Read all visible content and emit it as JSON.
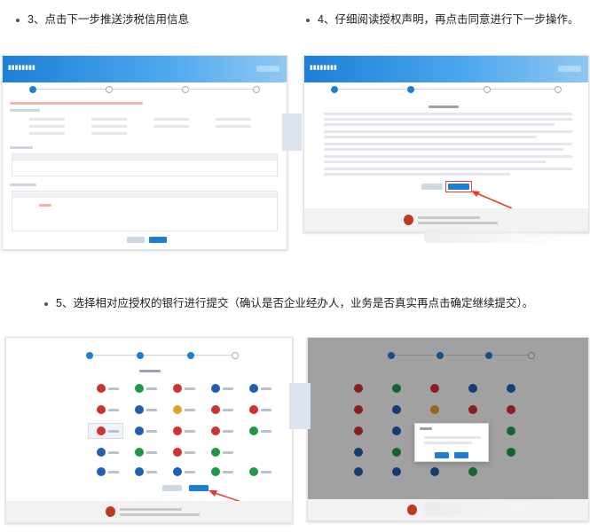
{
  "steps": {
    "step3": "3、点击下一步推送涉税信用信息",
    "step4": "4、仔细阅读授权声明，再点击同意进行下一步操作。",
    "step5": "5、选择相对应授权的银行进行提交（确认是否企业经办人，业务是否真实再点击确定继续提交）。"
  },
  "colors": {
    "header_blue": "#1c7fd6",
    "emblem_red": "#c0391f",
    "highlight_red": "#e53e2e",
    "bank_red": "#d0322d",
    "bank_green": "#1e9a47",
    "bank_blue": "#1f5fb4"
  },
  "icons": [
    "bank-logo-icon",
    "national-emblem-icon"
  ]
}
